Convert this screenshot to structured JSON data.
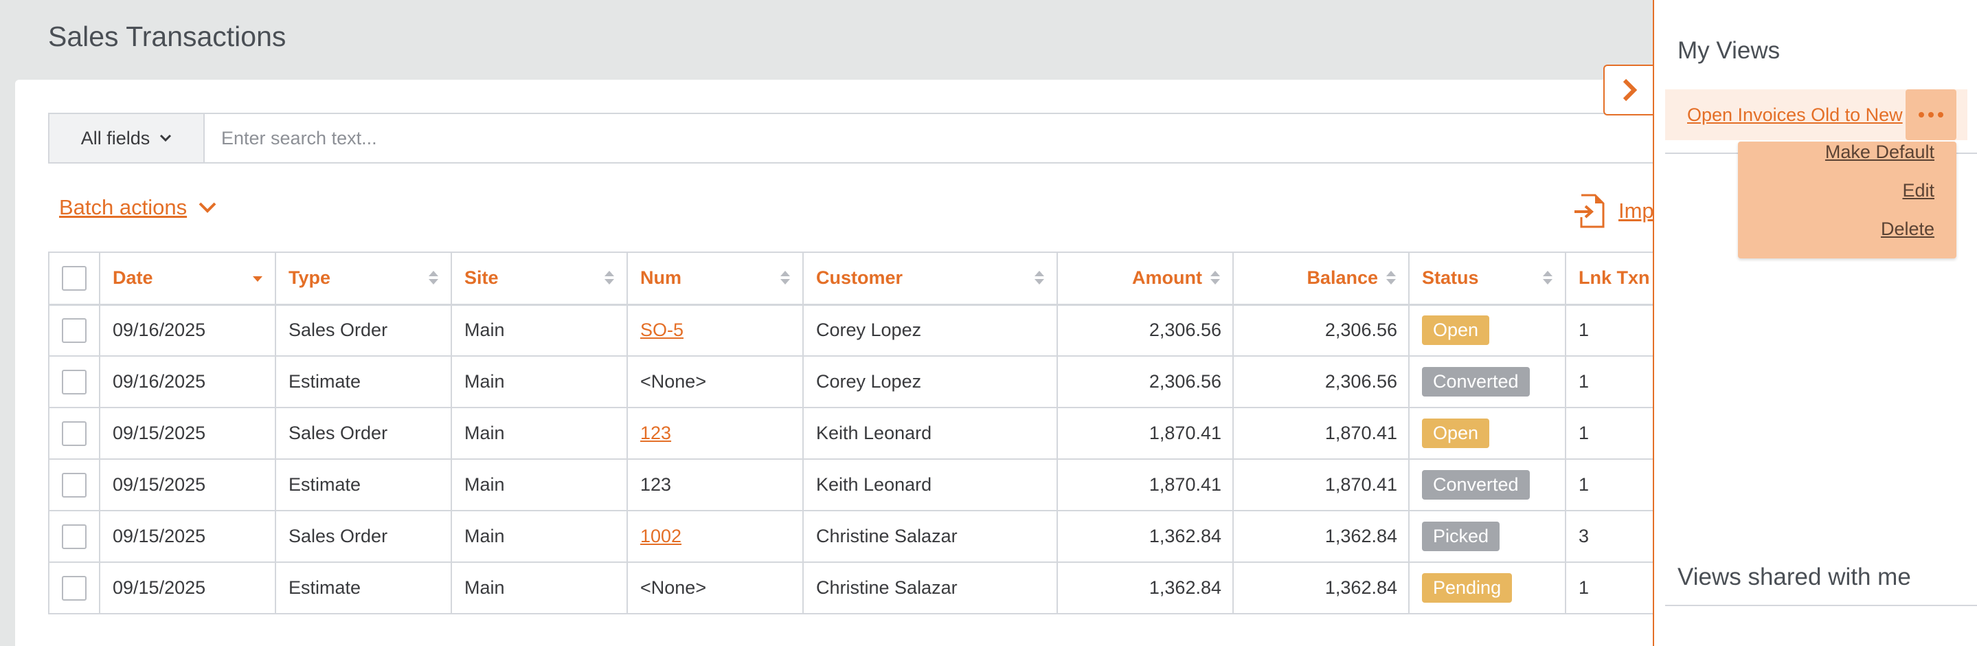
{
  "page": {
    "title": "Sales Transactions"
  },
  "search": {
    "field_label": "All fields",
    "placeholder": "Enter search text..."
  },
  "toolbar": {
    "batch_label": "Batch actions",
    "import_label": "Imp"
  },
  "table": {
    "headers": [
      "Date",
      "Type",
      "Site",
      "Num",
      "Customer",
      "Amount",
      "Balance",
      "Status",
      "Lnk Txn"
    ],
    "rows": [
      {
        "date": "09/16/2025",
        "type": "Sales Order",
        "site": "Main",
        "num": "SO-5",
        "num_link": true,
        "customer": "Corey Lopez",
        "amount": "2,306.56",
        "balance": "2,306.56",
        "status": "Open",
        "lnk": "1"
      },
      {
        "date": "09/16/2025",
        "type": "Estimate",
        "site": "Main",
        "num": "<None>",
        "num_link": false,
        "customer": "Corey Lopez",
        "amount": "2,306.56",
        "balance": "2,306.56",
        "status": "Converted",
        "lnk": "1"
      },
      {
        "date": "09/15/2025",
        "type": "Sales Order",
        "site": "Main",
        "num": "123",
        "num_link": true,
        "customer": "Keith Leonard",
        "amount": "1,870.41",
        "balance": "1,870.41",
        "status": "Open",
        "lnk": "1"
      },
      {
        "date": "09/15/2025",
        "type": "Estimate",
        "site": "Main",
        "num": "123",
        "num_link": false,
        "customer": "Keith Leonard",
        "amount": "1,870.41",
        "balance": "1,870.41",
        "status": "Converted",
        "lnk": "1"
      },
      {
        "date": "09/15/2025",
        "type": "Sales Order",
        "site": "Main",
        "num": "1002",
        "num_link": true,
        "customer": "Christine Salazar",
        "amount": "1,362.84",
        "balance": "1,362.84",
        "status": "Picked",
        "lnk": "3"
      },
      {
        "date": "09/15/2025",
        "type": "Estimate",
        "site": "Main",
        "num": "<None>",
        "num_link": false,
        "customer": "Christine Salazar",
        "amount": "1,362.84",
        "balance": "1,362.84",
        "status": "Pending",
        "lnk": "1"
      }
    ]
  },
  "status_colors": {
    "Open": "#e8b75f",
    "Converted": "#a3a6ab",
    "Picked": "#a3a6ab",
    "Pending": "#e8b75f"
  },
  "colors": {
    "accent": "#e46f27"
  },
  "panel": {
    "my_views_heading": "My Views",
    "view_name": "Open Invoices Old to New",
    "menu": {
      "make_default": "Make Default",
      "edit": "Edit",
      "delete": "Delete"
    },
    "shared_heading": "Views shared with me"
  }
}
